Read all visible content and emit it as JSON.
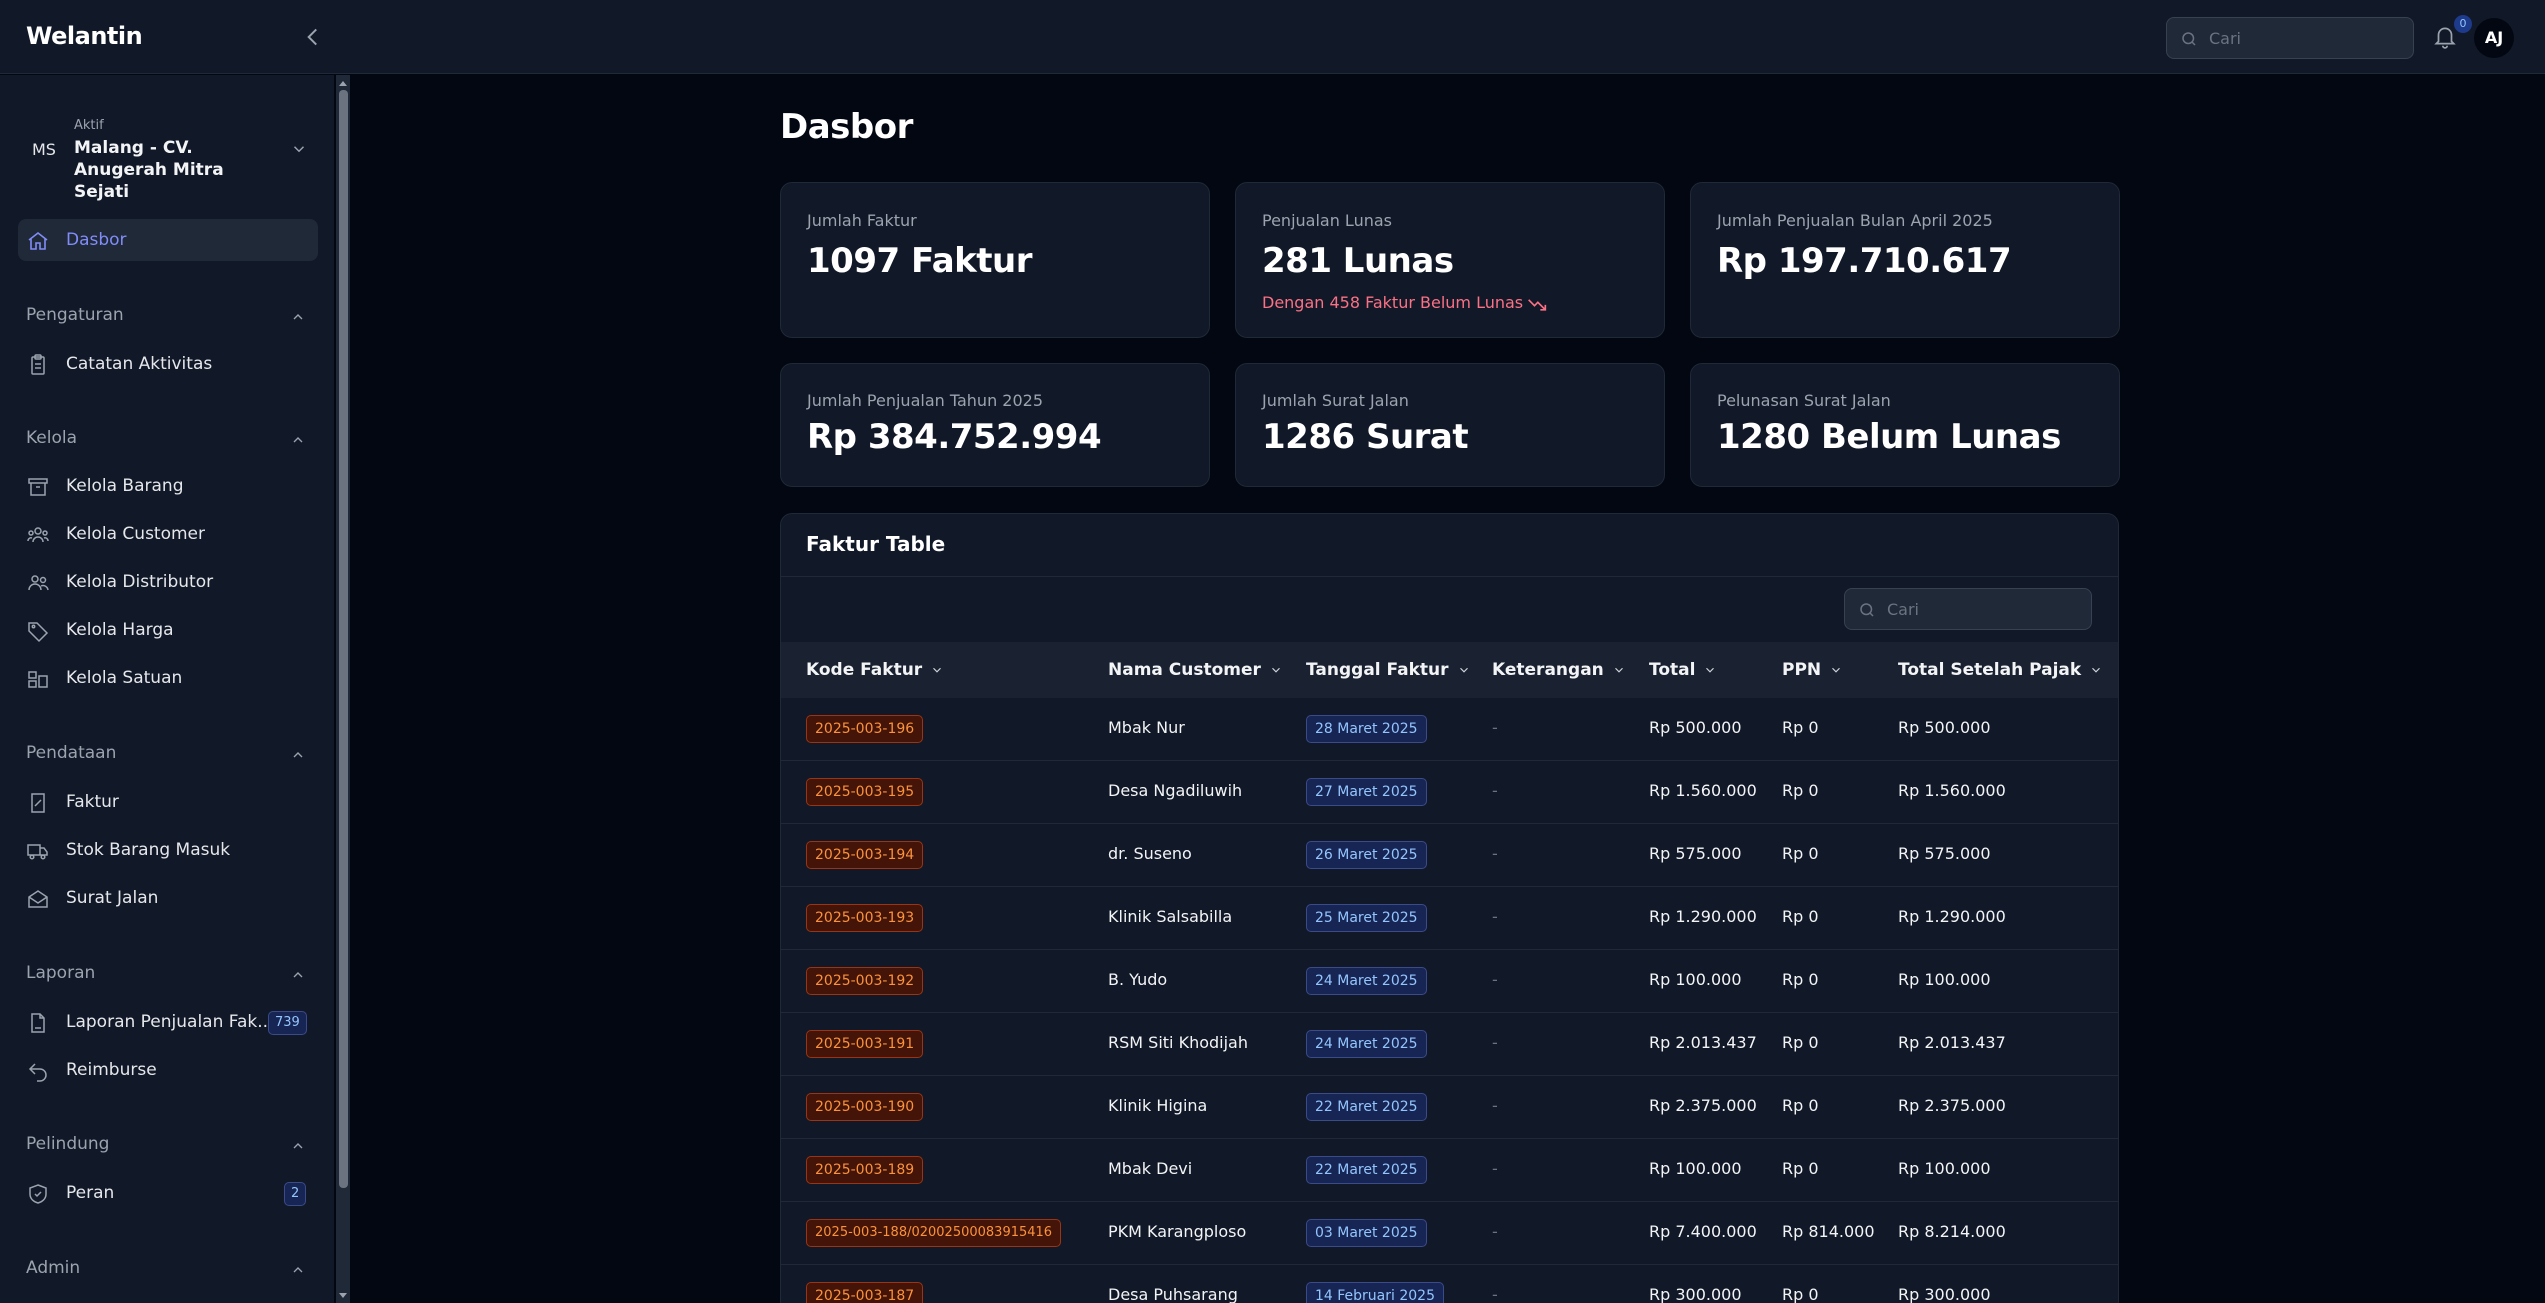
{
  "app": {
    "brand": "Welantin"
  },
  "topbar": {
    "search_placeholder": "Cari",
    "notifications_count": "0",
    "user_initials": "AJ"
  },
  "org": {
    "initials": "MS",
    "status": "Aktif",
    "name": "Malang - CV. Anugerah Mitra Sejati"
  },
  "sidebar": {
    "dashboard": "Dasbor",
    "sections": [
      {
        "title": "Pengaturan",
        "items": [
          {
            "label": "Catatan Aktivitas",
            "icon": "clipboard-icon"
          }
        ]
      },
      {
        "title": "Kelola",
        "items": [
          {
            "label": "Kelola Barang",
            "icon": "archive-icon"
          },
          {
            "label": "Kelola Customer",
            "icon": "users-icon"
          },
          {
            "label": "Kelola Distributor",
            "icon": "user-group-icon"
          },
          {
            "label": "Kelola Harga",
            "icon": "tag-icon"
          },
          {
            "label": "Kelola Satuan",
            "icon": "shapes-icon"
          }
        ]
      },
      {
        "title": "Pendataan",
        "items": [
          {
            "label": "Faktur",
            "icon": "receipt-icon"
          },
          {
            "label": "Stok Barang Masuk",
            "icon": "truck-icon"
          },
          {
            "label": "Surat Jalan",
            "icon": "envelope-icon"
          }
        ]
      },
      {
        "title": "Laporan",
        "items": [
          {
            "label": "Laporan Penjualan Fak...",
            "icon": "document-icon",
            "badge": "739"
          },
          {
            "label": "Reimburse",
            "icon": "undo-icon"
          }
        ]
      },
      {
        "title": "Pelindung",
        "items": [
          {
            "label": "Peran",
            "icon": "shield-icon",
            "badge": "2"
          }
        ]
      },
      {
        "title": "Admin",
        "items": []
      }
    ]
  },
  "page": {
    "title": "Dasbor"
  },
  "stats": [
    {
      "title": "Jumlah Faktur",
      "value": "1097 Faktur"
    },
    {
      "title": "Penjualan Lunas",
      "value": "281 Lunas",
      "sub": "Dengan 458 Faktur Belum Lunas"
    },
    {
      "title": "Jumlah Penjualan Bulan April 2025",
      "value": "Rp 197.710.617"
    },
    {
      "title": "Jumlah Penjualan Tahun 2025",
      "value": "Rp 384.752.994"
    },
    {
      "title": "Jumlah Surat Jalan",
      "value": "1286 Surat"
    },
    {
      "title": "Pelunasan Surat Jalan",
      "value": "1280 Belum Lunas"
    }
  ],
  "table": {
    "title": "Faktur Table",
    "search_placeholder": "Cari",
    "columns": [
      "Kode Faktur",
      "Nama Customer",
      "Tanggal Faktur",
      "Keterangan",
      "Total",
      "PPN",
      "Total Setelah Pajak"
    ],
    "rows": [
      [
        "2025-003-196",
        "Mbak Nur",
        "28 Maret 2025",
        "-",
        "Rp 500.000",
        "Rp 0",
        "Rp 500.000"
      ],
      [
        "2025-003-195",
        "Desa Ngadiluwih",
        "27 Maret 2025",
        "-",
        "Rp 1.560.000",
        "Rp 0",
        "Rp 1.560.000"
      ],
      [
        "2025-003-194",
        "dr. Suseno",
        "26 Maret 2025",
        "-",
        "Rp 575.000",
        "Rp 0",
        "Rp 575.000"
      ],
      [
        "2025-003-193",
        "Klinik Salsabilla",
        "25 Maret 2025",
        "-",
        "Rp 1.290.000",
        "Rp 0",
        "Rp 1.290.000"
      ],
      [
        "2025-003-192",
        "B. Yudo",
        "24 Maret 2025",
        "-",
        "Rp 100.000",
        "Rp 0",
        "Rp 100.000"
      ],
      [
        "2025-003-191",
        "RSM Siti Khodijah",
        "24 Maret 2025",
        "-",
        "Rp 2.013.437",
        "Rp 0",
        "Rp 2.013.437"
      ],
      [
        "2025-003-190",
        "Klinik Higina",
        "22 Maret 2025",
        "-",
        "Rp 2.375.000",
        "Rp 0",
        "Rp 2.375.000"
      ],
      [
        "2025-003-189",
        "Mbak Devi",
        "22 Maret 2025",
        "-",
        "Rp 100.000",
        "Rp 0",
        "Rp 100.000"
      ],
      [
        "2025-003-188/02002500083915416",
        "PKM Karangploso",
        "03 Maret 2025",
        "-",
        "Rp 7.400.000",
        "Rp 814.000",
        "Rp 8.214.000"
      ],
      [
        "2025-003-187",
        "Desa Puhsarang",
        "14 Februari 2025",
        "-",
        "Rp 300.000",
        "Rp 0",
        "Rp 300.000"
      ]
    ]
  },
  "colors": {
    "background": "#030712",
    "panel": "#111827",
    "accent": "#818cf8",
    "danger": "#fb7185",
    "code_badge": "#fb923c"
  }
}
